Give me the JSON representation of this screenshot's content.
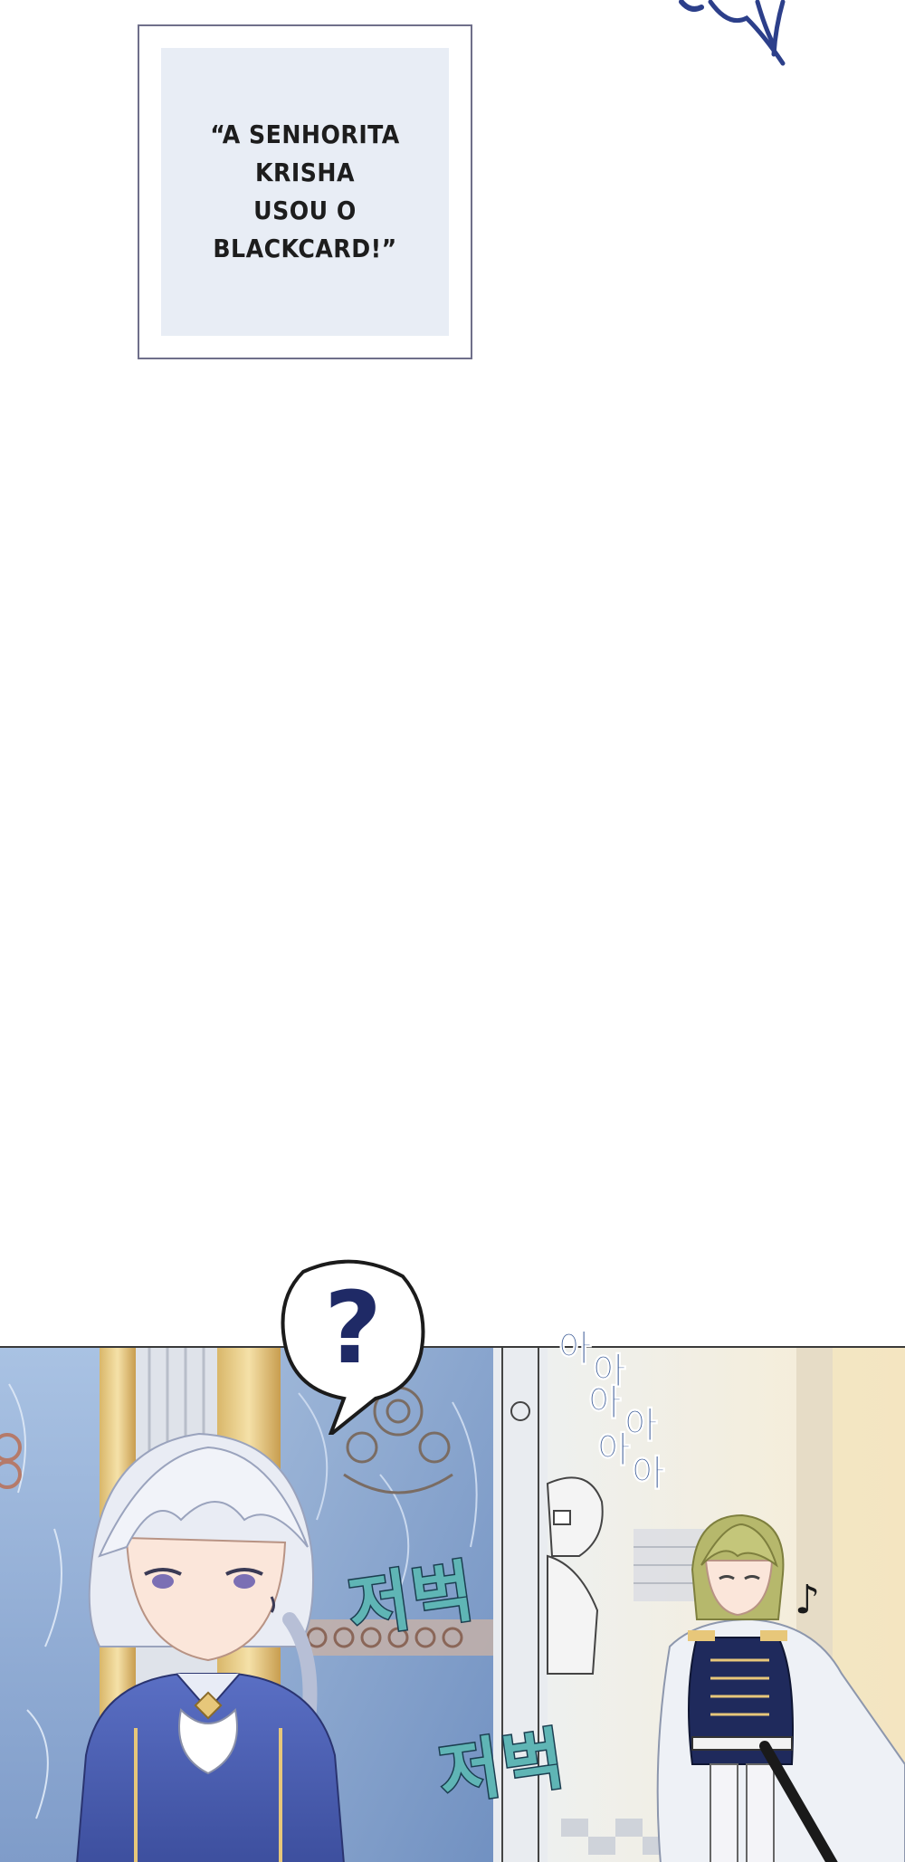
{
  "narration": {
    "text": "“A SENHORITA KRISHA\nUSOU O BLACKCARD!”"
  },
  "speech_bubble": {
    "symbol": "?"
  },
  "sfx": {
    "aya": [
      "아",
      "아",
      "아",
      "아",
      "아",
      "아"
    ],
    "jeobeok_1": "저벅",
    "jeobeok_2": "저벅",
    "music_note": "♪"
  },
  "colors": {
    "narration_bg": "#e8edf5",
    "narration_border": "#6f6f8a",
    "sfx_blue": "#3b5b96",
    "sfx_teal": "#5fb5b5"
  }
}
